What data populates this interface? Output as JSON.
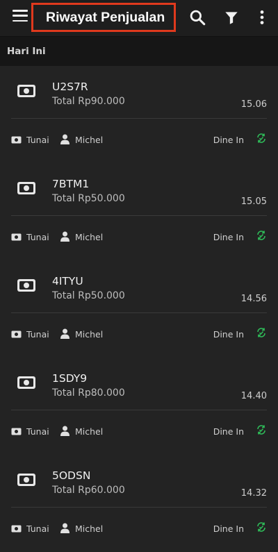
{
  "header": {
    "title": "Riwayat Penjualan"
  },
  "section": {
    "label": "Hari Ini"
  },
  "transactions": [
    {
      "code": "U2S7R",
      "total": "Total Rp90.000",
      "time": "15.06",
      "payment": "Tunai",
      "cashier": "Michel",
      "type": "Dine In"
    },
    {
      "code": "7BTM1",
      "total": "Total Rp50.000",
      "time": "15.05",
      "payment": "Tunai",
      "cashier": "Michel",
      "type": "Dine In"
    },
    {
      "code": "4ITYU",
      "total": "Total Rp50.000",
      "time": "14.56",
      "payment": "Tunai",
      "cashier": "Michel",
      "type": "Dine In"
    },
    {
      "code": "1SDY9",
      "total": "Total Rp80.000",
      "time": "14.40",
      "payment": "Tunai",
      "cashier": "Michel",
      "type": "Dine In"
    },
    {
      "code": "5ODSN",
      "total": "Total Rp60.000",
      "time": "14.32",
      "payment": "Tunai",
      "cashier": "Michel",
      "type": "Dine In"
    }
  ],
  "colors": {
    "background": "#161616",
    "card": "#232323",
    "highlight_border": "#e0391d",
    "synced": "#2fbf5a"
  },
  "icons": {
    "menu": "hamburger-menu-icon",
    "search": "search-icon",
    "filter": "filter-icon",
    "more": "more-vertical-icon",
    "money": "money-icon",
    "user": "user-icon",
    "sync": "sync-icon"
  }
}
